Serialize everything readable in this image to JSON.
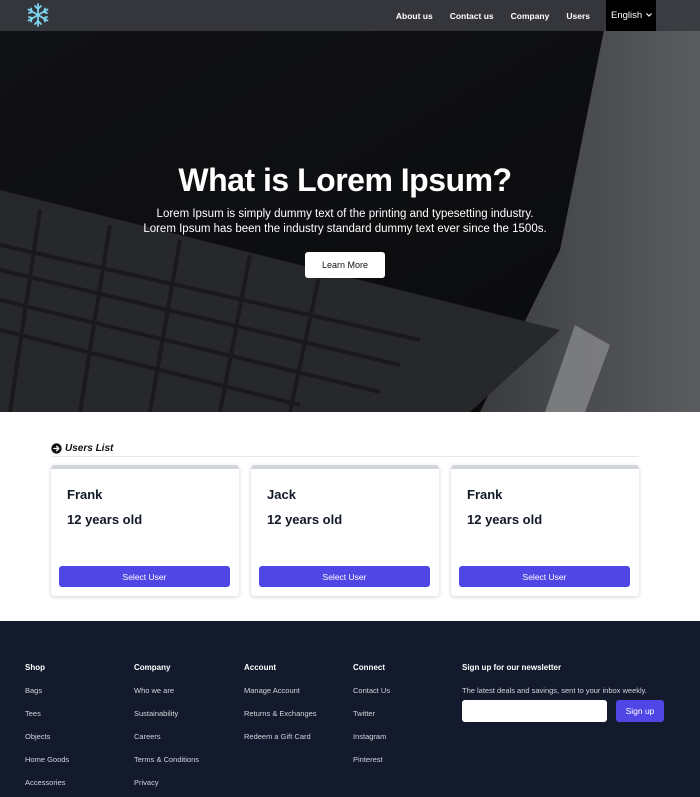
{
  "nav": {
    "logo_icon": "snowflake-icon",
    "links": [
      "About us",
      "Contact us",
      "Company",
      "Users"
    ],
    "language": "English"
  },
  "hero": {
    "title": "What is Lorem Ipsum?",
    "line1": "Lorem Ipsum is simply dummy text of the printing and typesetting industry.",
    "line2": "Lorem Ipsum has been the industry standard dummy text ever since the 1500s.",
    "button": "Learn More"
  },
  "users": {
    "heading": "Users List",
    "heading_icon": "arrow-right-circle-icon",
    "cards": [
      {
        "name": "Frank",
        "age": "12 years old",
        "button": "Select User"
      },
      {
        "name": "Jack",
        "age": "12 years old",
        "button": "Select User"
      },
      {
        "name": "Frank",
        "age": "12 years old",
        "button": "Select User"
      }
    ]
  },
  "footer": {
    "columns": [
      {
        "heading": "Shop",
        "links": [
          "Bags",
          "Tees",
          "Objects",
          "Home Goods",
          "Accessories"
        ]
      },
      {
        "heading": "Company",
        "links": [
          "Who we are",
          "Sustainability",
          "Careers",
          "Terms & Conditions",
          "Privacy"
        ]
      },
      {
        "heading": "Account",
        "links": [
          "Manage Account",
          "Returns & Exchanges",
          "Redeem a Gift Card"
        ]
      },
      {
        "heading": "Connect",
        "links": [
          "Contact Us",
          "Twitter",
          "Instagram",
          "Pinterest"
        ]
      }
    ],
    "newsletter": {
      "heading": "Sign up for our newsletter",
      "text": "The latest deals and savings, sent to your inbox weekly.",
      "input_value": "",
      "button": "Sign up"
    }
  },
  "colors": {
    "accent": "#4f46e5",
    "footer_bg": "#131a2c",
    "nav_bg": "#373a40"
  }
}
